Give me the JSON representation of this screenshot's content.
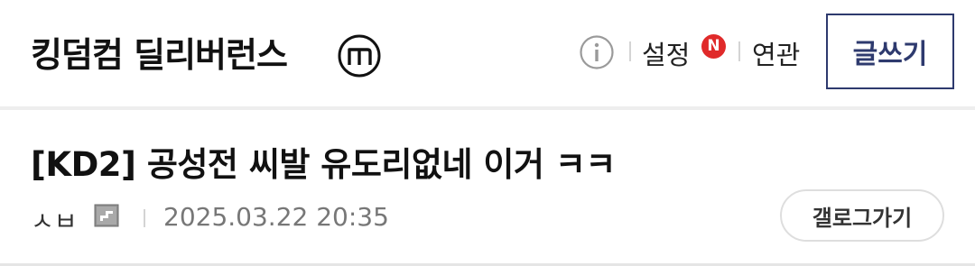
{
  "header": {
    "gallery_title": "킹덤컴 딜리버런스",
    "badge_icon": "minor-gallery-m-icon",
    "settings_label": "설정",
    "new_badge": "N",
    "related_label": "연관",
    "write_label": "글쓰기"
  },
  "post": {
    "title": "[KD2] 공성전 씨발 유도리없네 이거 ㅋㅋ",
    "author": "ㅅㅂ",
    "date": "2025.03.22 20:35",
    "gallery_button_label": "갤로그가기"
  },
  "colors": {
    "accent_navy": "#2e3a6e",
    "new_badge_red": "#e02a2a",
    "divider_gray": "#eeeeee",
    "date_gray": "#777777"
  }
}
